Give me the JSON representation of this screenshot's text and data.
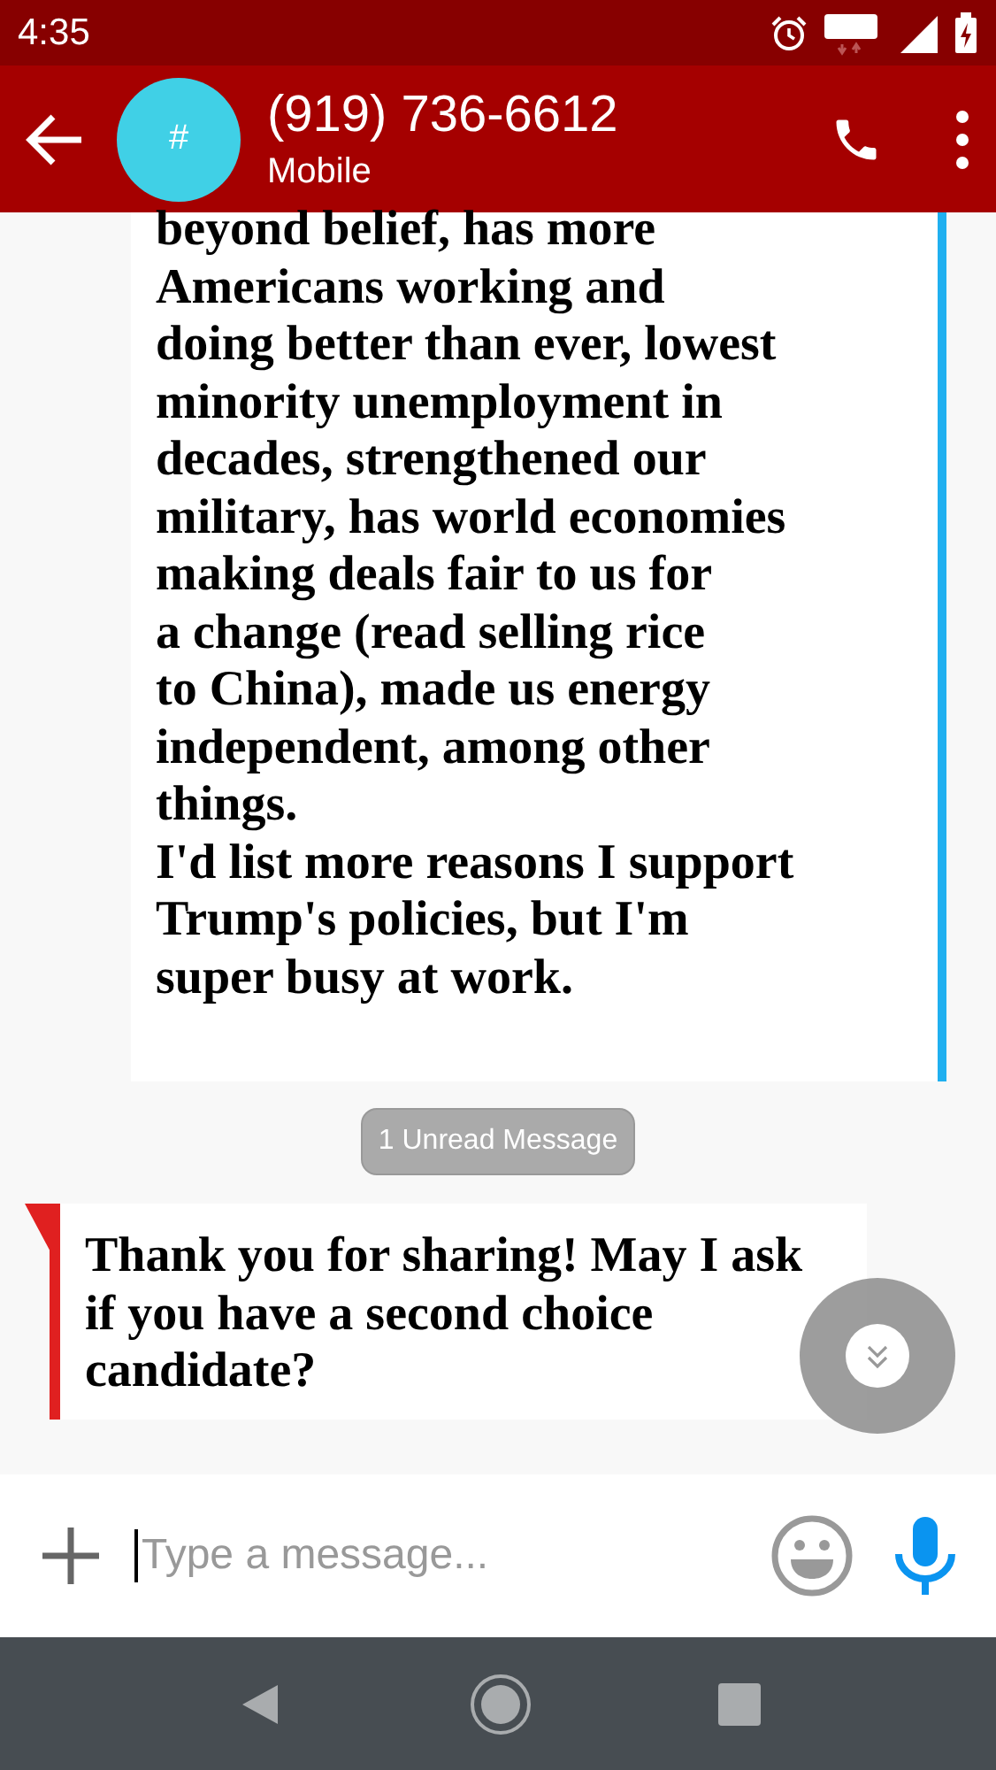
{
  "status_bar": {
    "time": "4:35"
  },
  "header": {
    "avatar": "#",
    "title": "(919) 736-6612",
    "subtitle": "Mobile"
  },
  "messages": [
    {
      "kind": "sent",
      "text": "beyond belief, has more\nAmericans working and\ndoing better than ever, lowest\nminority unemployment in\ndecades, strengthened our\nmilitary, has world economies\nmaking deals fair to us for\na change (read selling rice\nto China), made us energy\nindependent, among other\nthings.\nI'd list more reasons I support\nTrump's policies, but I'm\nsuper busy at work."
    },
    {
      "kind": "divider",
      "text": "1 Unread Message"
    },
    {
      "kind": "received",
      "text": "Thank you for sharing! May I ask if you have a second choice candidate?"
    }
  ],
  "composer": {
    "placeholder": "Type a message..."
  }
}
